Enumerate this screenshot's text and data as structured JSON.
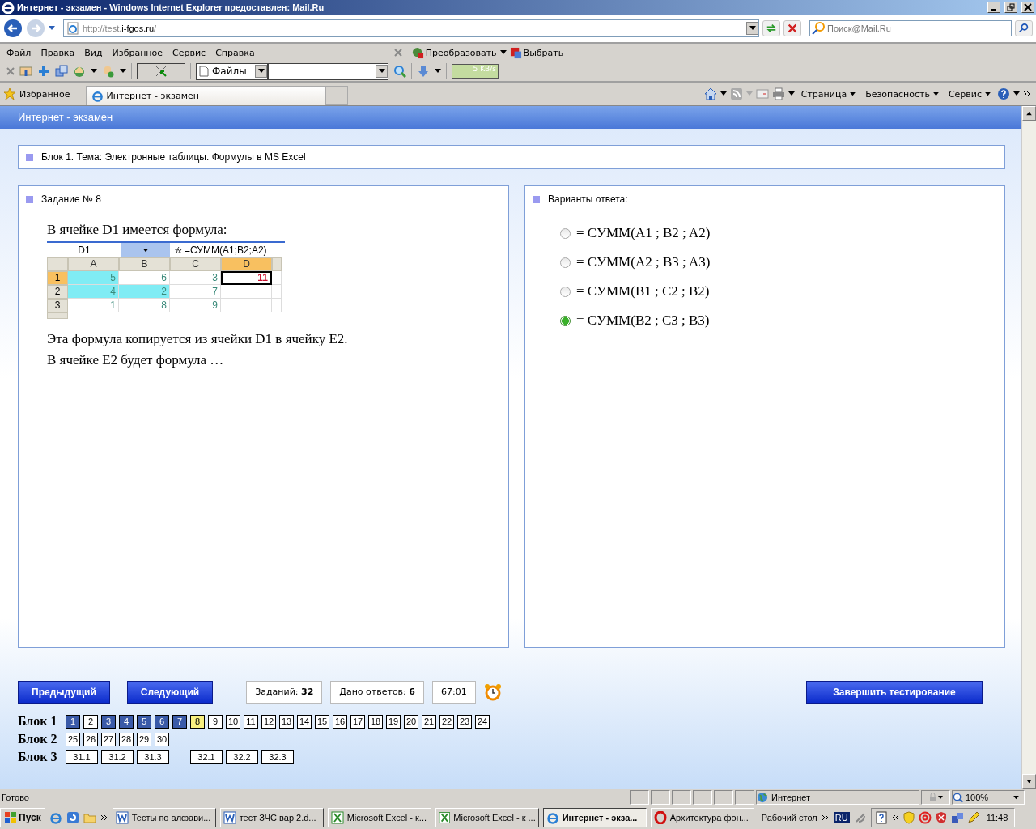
{
  "window": {
    "title": "Интернет - экзамен - Windows Internet Explorer предоставлен: Mail.Ru"
  },
  "address_bar": {
    "url_prefix": "http://test.",
    "url_domain": "i-fgos.ru",
    "url_suffix": "/"
  },
  "search": {
    "placeholder": "Поиск@Mail.Ru"
  },
  "menu": [
    "Файл",
    "Правка",
    "Вид",
    "Избранное",
    "Сервис",
    "Справка"
  ],
  "addon_buttons": [
    "Преобразовать",
    "Выбрать"
  ],
  "toolbar": {
    "files_dropdown": "Файлы",
    "speed": "5 KB/s"
  },
  "favorites": {
    "label": "Избранное"
  },
  "tabs": [
    {
      "label": "Интернет - экзамен",
      "selected": true
    }
  ],
  "command_bar": [
    "Страница",
    "Безопасность",
    "Сервис"
  ],
  "page": {
    "header": "Интернет - экзамен",
    "block_title": "Блок 1. Тема: Электронные таблицы. Формулы в MS Excel"
  },
  "question": {
    "title": "Задание № 8",
    "intro": "В ячейке D1 имеется формула:",
    "spreadsheet": {
      "name_box": "D1",
      "formula": "=СУММ(A1;B2;A2)",
      "columns": [
        {
          "label": "A",
          "selected": false
        },
        {
          "label": "B",
          "selected": false
        },
        {
          "label": "C",
          "selected": false
        },
        {
          "label": "D",
          "selected": true
        }
      ],
      "rows": [
        {
          "header": "1",
          "selected": true,
          "cells": [
            {
              "value": "5",
              "highlighted": true,
              "active": false
            },
            {
              "value": "6",
              "highlighted": false,
              "active": false
            },
            {
              "value": "3",
              "highlighted": false,
              "active": false
            },
            {
              "value": "11",
              "highlighted": false,
              "active": true
            }
          ]
        },
        {
          "header": "2",
          "selected": false,
          "cells": [
            {
              "value": "4",
              "highlighted": true,
              "active": false
            },
            {
              "value": "2",
              "highlighted": true,
              "active": false
            },
            {
              "value": "7",
              "highlighted": false,
              "active": false
            },
            {
              "highlighted": false,
              "active": false
            }
          ]
        },
        {
          "header": "3",
          "selected": false,
          "cells": [
            {
              "value": "1",
              "highlighted": false,
              "active": false
            },
            {
              "value": "8",
              "highlighted": false,
              "active": false
            },
            {
              "value": "9",
              "highlighted": false,
              "active": false
            },
            {
              "highlighted": false,
              "active": false
            }
          ]
        }
      ]
    },
    "lines": [
      "Эта формула копируется из ячейки D1 в ячейку E2.",
      "В ячейке E2 будет формула …"
    ]
  },
  "answers": {
    "title": "Варианты ответа:",
    "options": [
      {
        "label": "= СУММ(A1 ; B2 ; A2)",
        "selected": false
      },
      {
        "label": "= СУММ(A2 ; B3 ; A3)",
        "selected": false
      },
      {
        "label": "= СУММ(B1 ; C2 ; B2)",
        "selected": false
      },
      {
        "label": "= СУММ(B2 ; C3 ; B3)",
        "selected": true
      }
    ]
  },
  "navigation": {
    "previous": "Предыдущий",
    "next": "Следующий",
    "tasks_label": "Заданий:",
    "tasks_value": "32",
    "answered_label": "Дано ответов:",
    "answered_value": "6",
    "timer": "67:01",
    "finish": "Завершить тестирование"
  },
  "blocks": [
    {
      "label": "Блок 1",
      "groups": [
        [
          {
            "label": "1",
            "answered": true,
            "selected": false
          },
          {
            "label": "2",
            "answered": false,
            "selected": false
          },
          {
            "label": "3",
            "answered": true,
            "selected": false
          },
          {
            "label": "4",
            "answered": true,
            "selected": false
          },
          {
            "label": "5",
            "answered": true,
            "selected": false
          },
          {
            "label": "6",
            "answered": true,
            "selected": false
          },
          {
            "label": "7",
            "answered": true,
            "selected": false
          },
          {
            "label": "8",
            "answered": false,
            "selected": true
          },
          {
            "label": "9",
            "answered": false,
            "selected": false
          },
          {
            "label": "10",
            "answered": false,
            "selected": false
          },
          {
            "label": "11",
            "answered": false,
            "selected": false
          },
          {
            "label": "12",
            "answered": false,
            "selected": false
          },
          {
            "label": "13",
            "answered": false,
            "selected": false
          },
          {
            "label": "14",
            "answered": false,
            "selected": false
          },
          {
            "label": "15",
            "answered": false,
            "selected": false
          },
          {
            "label": "16",
            "answered": false,
            "selected": false
          },
          {
            "label": "17",
            "answered": false,
            "selected": false
          },
          {
            "label": "18",
            "answered": false,
            "selected": false
          },
          {
            "label": "19",
            "answered": false,
            "selected": false
          },
          {
            "label": "20",
            "answered": false,
            "selected": false
          },
          {
            "label": "21",
            "answered": false,
            "selected": false
          },
          {
            "label": "22",
            "answered": false,
            "selected": false
          },
          {
            "label": "23",
            "answered": false,
            "selected": false
          },
          {
            "label": "24",
            "answered": false,
            "selected": false
          }
        ]
      ]
    },
    {
      "label": "Блок 2",
      "groups": [
        [
          {
            "label": "25",
            "answered": false,
            "selected": false
          },
          {
            "label": "26",
            "answered": false,
            "selected": false
          },
          {
            "label": "27",
            "answered": false,
            "selected": false
          },
          {
            "label": "28",
            "answered": false,
            "selected": false
          },
          {
            "label": "29",
            "answered": false,
            "selected": false
          },
          {
            "label": "30",
            "answered": false,
            "selected": false
          }
        ]
      ]
    },
    {
      "label": "Блок 3",
      "groups": [
        [
          {
            "label": "31.1",
            "answered": false,
            "selected": false
          },
          {
            "label": "31.2",
            "answered": false,
            "selected": false
          },
          {
            "label": "31.3",
            "answered": false,
            "selected": false
          }
        ],
        [
          {
            "label": "32.1",
            "answered": false,
            "selected": false
          },
          {
            "label": "32.2",
            "answered": false,
            "selected": false
          },
          {
            "label": "32.3",
            "answered": false,
            "selected": false
          }
        ]
      ]
    }
  ],
  "status_bar": {
    "text": "Готово",
    "zone": "Интернет",
    "zoom": "100%"
  },
  "taskbar": {
    "start": "Пуск",
    "tasks": [
      {
        "label": "Тесты по алфави...",
        "kind": "word",
        "selected": false
      },
      {
        "label": "тест ЗЧС вар 2.d...",
        "kind": "word",
        "selected": false
      },
      {
        "label": "Microsoft Excel - к...",
        "kind": "excel",
        "selected": false
      },
      {
        "label": "Microsoft Excel - к ...",
        "kind": "excel",
        "selected": false
      },
      {
        "label": "Интернет - экза...",
        "kind": "ie",
        "selected": true
      },
      {
        "label": "Архитектура фон...",
        "kind": "opera",
        "selected": false
      }
    ],
    "desktop": "Рабочий стол",
    "language": "RU",
    "clock": "11:48"
  }
}
